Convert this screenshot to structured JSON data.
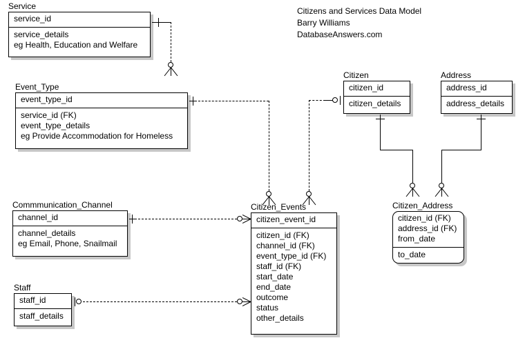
{
  "diagram": {
    "caption": {
      "title": "Citizens and Services Data Model",
      "author": "Barry Williams",
      "site": "DatabaseAnswers.com"
    },
    "entities": {
      "service": {
        "name": "Service",
        "pk": [
          "service_id"
        ],
        "attrs": [
          "service_details",
          "eg Health, Education and Welfare"
        ]
      },
      "event_type": {
        "name": "Event_Type",
        "pk": [
          "event_type_id"
        ],
        "attrs": [
          "service_id (FK)",
          "event_type_details",
          "eg Provide Accommodation for Homeless"
        ]
      },
      "communication_channel": {
        "name": "Commmunication_Channel",
        "pk": [
          "channel_id"
        ],
        "attrs": [
          "channel_details",
          "eg Email, Phone, Snailmail"
        ]
      },
      "staff": {
        "name": "Staff",
        "pk": [
          "staff_id"
        ],
        "attrs": [
          "staff_details"
        ]
      },
      "citizen": {
        "name": "Citizen",
        "pk": [
          "citizen_id"
        ],
        "attrs": [
          "citizen_details"
        ]
      },
      "address": {
        "name": "Address",
        "pk": [
          "address_id"
        ],
        "attrs": [
          "address_details"
        ]
      },
      "citizen_events": {
        "name": "Citizen_Events",
        "pk": [
          "citizen_event_id"
        ],
        "attrs": [
          "citizen_id (FK)",
          "channel_id (FK)",
          "event_type_id (FK)",
          "staff_id (FK)",
          "start_date",
          "end_date",
          "outcome",
          "status",
          "other_details"
        ]
      },
      "citizen_address": {
        "name": "Citizen_Address",
        "pk": [
          "citizen_id (FK)",
          "address_id (FK)",
          "from_date"
        ],
        "attrs": [
          "to_date"
        ]
      }
    },
    "relationships": [
      {
        "name": "service-to-event-type",
        "from": "Service",
        "to": "Event_Type",
        "line": "dashed",
        "from_cardinality": "one",
        "to_cardinality": "zero-or-many"
      },
      {
        "name": "event-type-to-citizen-events",
        "from": "Event_Type",
        "to": "Citizen_Events",
        "line": "dashed",
        "from_cardinality": "one",
        "to_cardinality": "zero-or-many"
      },
      {
        "name": "citizen-to-citizen-events",
        "from": "Citizen",
        "to": "Citizen_Events",
        "line": "dashed",
        "from_cardinality": "zero-or-one",
        "to_cardinality": "zero-or-many"
      },
      {
        "name": "communication-channel-to-citizen-events",
        "from": "Commmunication_Channel",
        "to": "Citizen_Events",
        "line": "dashed",
        "from_cardinality": "one",
        "to_cardinality": "zero-or-many"
      },
      {
        "name": "staff-to-citizen-events",
        "from": "Staff",
        "to": "Citizen_Events",
        "line": "dashed",
        "from_cardinality": "zero-or-one",
        "to_cardinality": "zero-or-many"
      },
      {
        "name": "citizen-to-citizen-address",
        "from": "Citizen",
        "to": "Citizen_Address",
        "line": "solid",
        "from_cardinality": "one",
        "to_cardinality": "zero-or-many"
      },
      {
        "name": "address-to-citizen-address",
        "from": "Address",
        "to": "Citizen_Address",
        "line": "solid",
        "from_cardinality": "one",
        "to_cardinality": "zero-or-many"
      }
    ]
  }
}
